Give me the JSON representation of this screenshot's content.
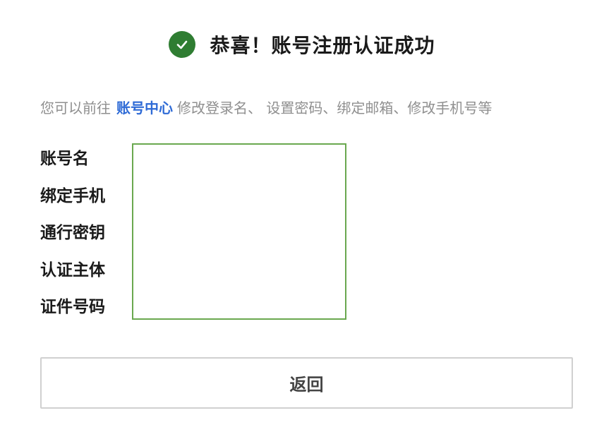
{
  "header": {
    "icon": "check-circle-icon",
    "title": "恭喜！账号注册认证成功",
    "icon_color": "#2f7d32"
  },
  "hint": {
    "prefix": "您可以前往",
    "link_label": "账号中心",
    "suffix": "修改登录名、 设置密码、绑定邮箱、修改手机号等",
    "link_color": "#2f6bd6"
  },
  "fields": [
    {
      "label": "账号名"
    },
    {
      "label": "绑定手机"
    },
    {
      "label": "通行密钥"
    },
    {
      "label": "认证主体"
    },
    {
      "label": "证件号码"
    }
  ],
  "info_box": {
    "border_color": "#6aa84f"
  },
  "back_button": {
    "label": "返回"
  }
}
